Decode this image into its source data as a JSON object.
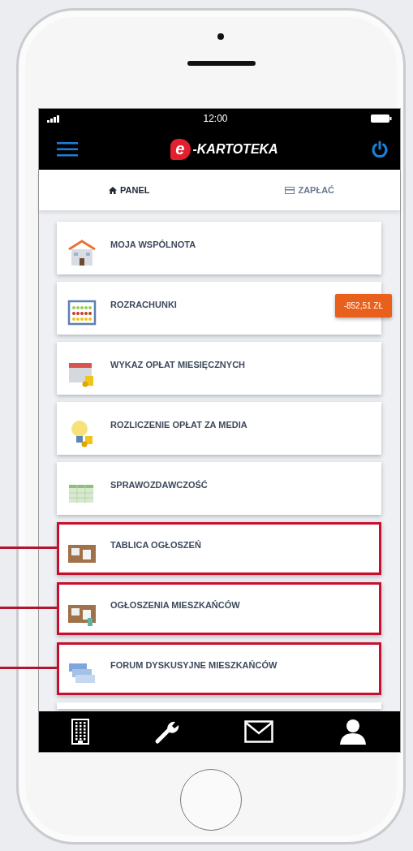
{
  "status_bar": {
    "time": "12:00"
  },
  "header": {
    "logo_letter": "e",
    "logo_text": "-KARTOTEKA"
  },
  "tabs": [
    {
      "label": "PANEL",
      "selected": true
    },
    {
      "label": "ZAPŁAĆ",
      "selected": false
    }
  ],
  "menu_items": [
    {
      "label": "MOJA WSPÓLNOTA",
      "highlighted": false
    },
    {
      "label": "ROZRACHUNKI",
      "highlighted": false,
      "badge": "-852,51 ZŁ"
    },
    {
      "label": "WYKAZ OPŁAT MIESIĘCZNYCH",
      "highlighted": false
    },
    {
      "label": "ROZLICZENIE OPŁAT ZA MEDIA",
      "highlighted": false
    },
    {
      "label": "SPRAWOZDAWCZOŚĆ",
      "highlighted": false
    },
    {
      "label": "TABLICA OGŁOSZEŃ",
      "highlighted": true
    },
    {
      "label": "OGŁOSZENIA MIESZKAŃCÓW",
      "highlighted": true
    },
    {
      "label": "FORUM DYSKUSYJNE MIESZKAŃCÓW",
      "highlighted": true
    }
  ]
}
